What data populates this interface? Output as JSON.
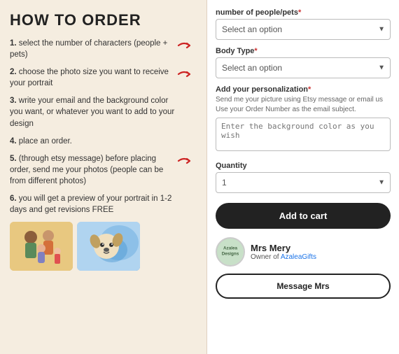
{
  "title": "HOW TO ORDER",
  "steps": [
    {
      "number": "1.",
      "text": "select the number of characters (people + pets)",
      "has_arrow": true
    },
    {
      "number": "2.",
      "text": "choose the photo size you want to receive your portrait",
      "has_arrow": true
    },
    {
      "number": "3.",
      "text": "write your email and the background color you want, or whatever you want to add to your design",
      "has_arrow": false
    },
    {
      "number": "4.",
      "text": "place an order.",
      "has_arrow": false
    },
    {
      "number": "5.",
      "text": "(through etsy message) before placing order, send me your photos (people can be from different photos)",
      "has_arrow": true
    },
    {
      "number": "6.",
      "text": "you will get a preview of your portrait in 1-2 days and get revisions FREE",
      "has_arrow": false
    }
  ],
  "form": {
    "people_label": "number of people/pets",
    "people_placeholder": "Select an option",
    "body_type_label": "Body Type",
    "body_type_placeholder": "Select an option",
    "personalization_label": "Add your personalization",
    "personalization_hint1": "Send me your picture using Etsy message or email us",
    "personalization_hint2": "Use your Order Number as the email subject.",
    "personalization_placeholder": "Enter the background color as you wish",
    "quantity_label": "Quantity",
    "quantity_value": "1",
    "add_to_cart_label": "Add to cart",
    "seller_name": "Mrs Mery",
    "seller_role": "Owner of",
    "seller_shop": "AzaleaGifts",
    "message_btn_label": "Message Mrs"
  },
  "colors": {
    "required_star": "#cc3333",
    "arrow": "#cc2222",
    "button_bg": "#222222",
    "background": "#f5ede0"
  }
}
